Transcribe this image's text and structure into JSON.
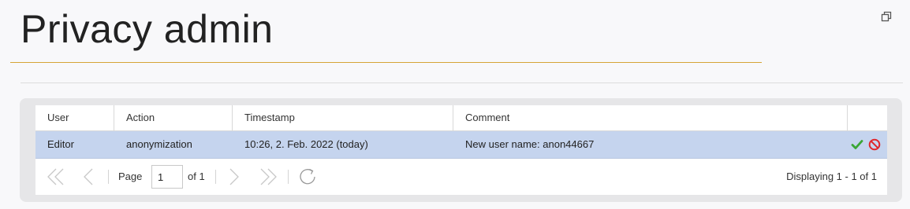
{
  "page": {
    "title": "Privacy admin"
  },
  "grid": {
    "columns": [
      "User",
      "Action",
      "Timestamp",
      "Comment",
      ""
    ],
    "rows": [
      {
        "user": "Editor",
        "action": "anonymization",
        "timestamp": "10:26, 2. Feb. 2022 (today)",
        "comment": "New user name: anon44667",
        "actions": [
          "accept-check-icon",
          "reject-ban-icon"
        ]
      }
    ]
  },
  "pager": {
    "page_label": "Page",
    "current_page": "1",
    "of_label": "of 1",
    "displaying": "Displaying 1 - 1 of 1"
  },
  "colors": {
    "title_underline": "#d6a436",
    "selected_row": "#c5d4ee",
    "accept": "#3aa635",
    "reject": "#e0262b"
  }
}
